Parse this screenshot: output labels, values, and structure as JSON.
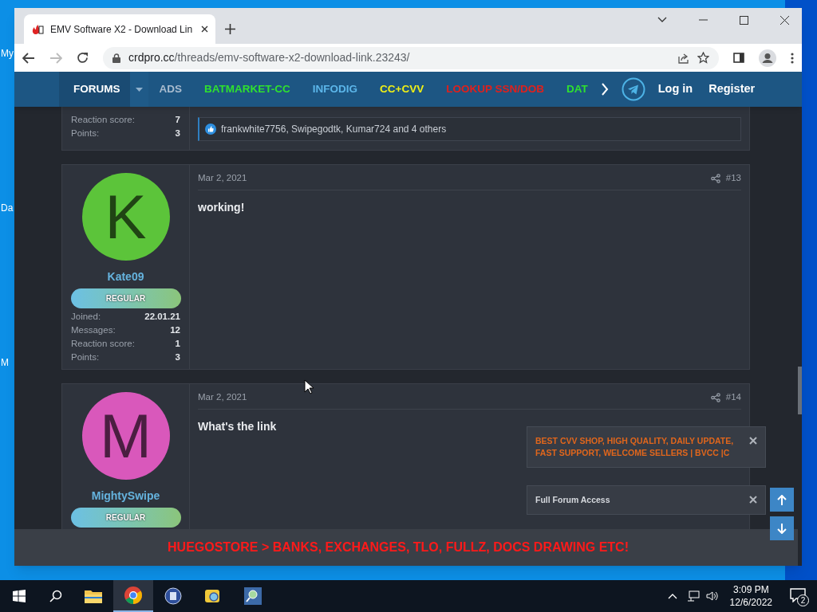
{
  "desktop": {
    "icon_labels": [
      "My",
      "Da",
      "M"
    ]
  },
  "browser": {
    "tab_title": "EMV Software X2 - Download Lin",
    "url_host": "crdpro.cc",
    "url_path": "/threads/emv-software-x2-download-link.23243/"
  },
  "nav": {
    "items": [
      {
        "label": "FORUMS",
        "color": "#ffffff",
        "selected": true
      },
      {
        "label": "ADS",
        "color": "#a9bccf",
        "selected": false
      },
      {
        "label": "BATMARKET-CC",
        "color": "#2fe02f",
        "selected": false
      },
      {
        "label": "INFODIG",
        "color": "#5cb6ea",
        "selected": false
      },
      {
        "label": "CC+CVV",
        "color": "#f0f016",
        "selected": false
      },
      {
        "label": "LOOKUP SSN/DOB",
        "color": "#e0201c",
        "selected": false
      },
      {
        "label": "DAT",
        "color": "#2fe02f",
        "selected": false
      }
    ],
    "login": "Log in",
    "register": "Register"
  },
  "posts": [
    {
      "kind": "partial",
      "stats": [
        {
          "label": "Reaction score:",
          "value": "7"
        },
        {
          "label": "Points:",
          "value": "3"
        }
      ],
      "reactions": "frankwhite7756, Swipegodtk, Kumar724 and 4 others"
    },
    {
      "kind": "full",
      "letter": "K",
      "color": "#5cc43a",
      "username": "Kate09",
      "badge": "REGULAR",
      "stats": [
        {
          "label": "Joined:",
          "value": "22.01.21"
        },
        {
          "label": "Messages:",
          "value": "12"
        },
        {
          "label": "Reaction score:",
          "value": "1"
        },
        {
          "label": "Points:",
          "value": "3"
        }
      ],
      "date": "Mar 2, 2021",
      "number": "#13",
      "message": "working!"
    },
    {
      "kind": "full",
      "letter": "M",
      "color": "#d958bb",
      "username": "MightySwipe",
      "badge": "REGULAR",
      "date": "Mar 2, 2021",
      "number": "#14",
      "message": "What's the link"
    }
  ],
  "notices": [
    {
      "text": "BEST CVV SHOP, HIGH QUALITY, DAILY UPDATE, FAST SUPPORT, WELCOME SELLERS | BVCC |C",
      "color": "#e0661c"
    },
    {
      "text": "Full Forum Access",
      "color": "#d6d9de"
    }
  ],
  "banner": "HUEGOSTORE > BANKS, EXCHANGES, TLO, FULLZ, DOCS DRAWING ETC!",
  "taskbar": {
    "time": "3:09 PM",
    "date": "12/6/2022",
    "notifications": "2"
  }
}
